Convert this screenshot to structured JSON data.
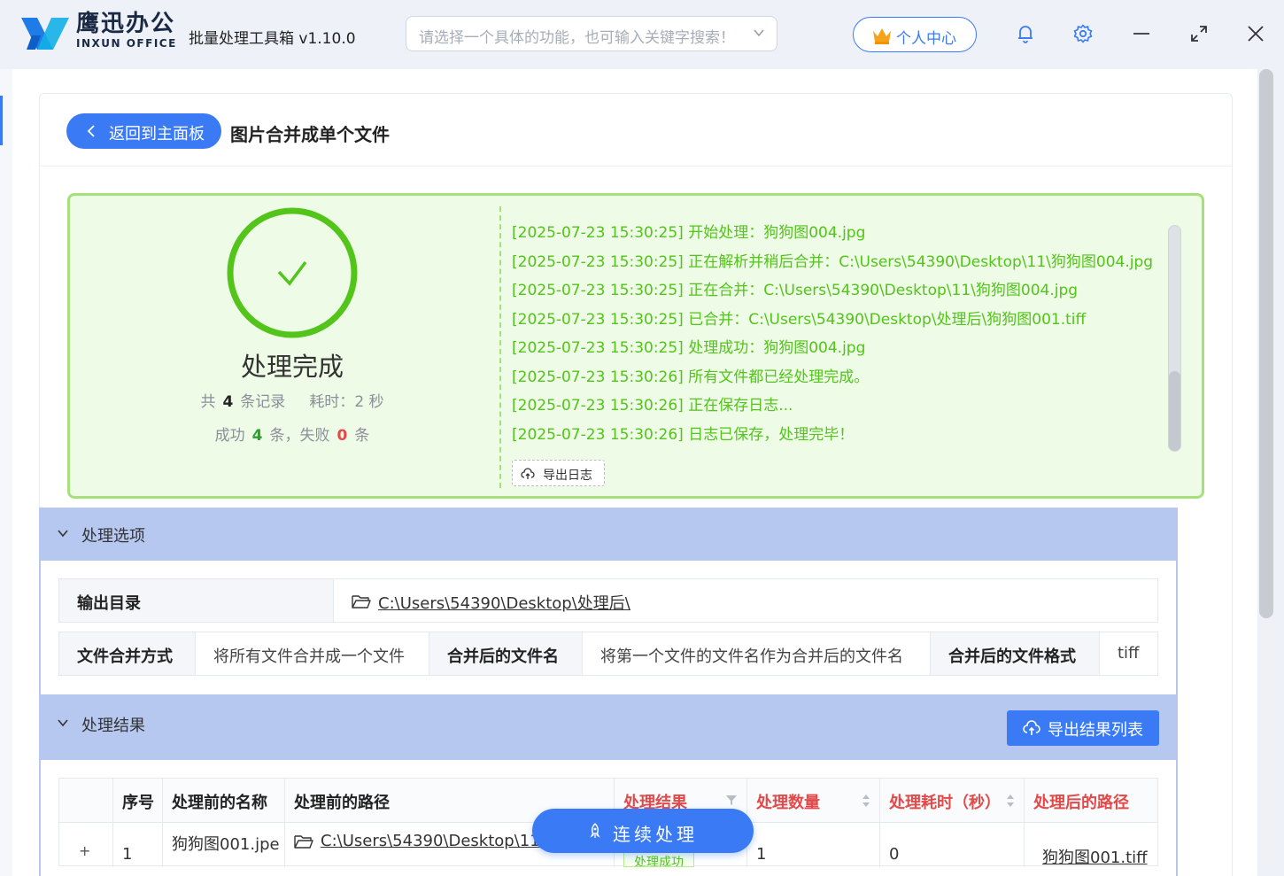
{
  "brand": {
    "name_cn": "鹰迅办公",
    "name_en": "INXUN OFFICE"
  },
  "app": {
    "title": "批量处理工具箱 v1.10.0"
  },
  "search": {
    "placeholder": "请选择一个具体的功能，也可输入关键字搜索！"
  },
  "toolbar": {
    "user_center": "个人中心"
  },
  "header": {
    "back_label": "返回到主面板",
    "page_title": "图片合并成单个文件"
  },
  "result": {
    "status": "处理完成",
    "total_prefix": "共",
    "total": "4",
    "total_suffix": "条记录",
    "time_prefix": "耗时：",
    "time_value": "2",
    "time_unit": "秒",
    "success_prefix": "成功",
    "success": "4",
    "success_suffix": "条，失败",
    "fail": "0",
    "fail_suffix": "条",
    "export_log": "导出日志",
    "log_lines": [
      "[2025-07-23 15:30:25] 开始处理：狗狗图004.jpg",
      "[2025-07-23 15:30:25] 正在解析并稍后合并：C:\\Users\\54390\\Desktop\\11\\狗狗图004.jpg",
      "[2025-07-23 15:30:25] 正在合并：C:\\Users\\54390\\Desktop\\11\\狗狗图004.jpg",
      "[2025-07-23 15:30:25] 已合并：C:\\Users\\54390\\Desktop\\处理后\\狗狗图001.tiff",
      "[2025-07-23 15:30:25] 处理成功：狗狗图004.jpg",
      "[2025-07-23 15:30:26] 所有文件都已经处理完成。",
      "[2025-07-23 15:30:26] 正在保存日志...",
      "[2025-07-23 15:30:26] 日志已保存，处理完毕！"
    ]
  },
  "options": {
    "section_title": "处理选项",
    "output_dir_label": "输出目录",
    "output_dir_value": "C:\\Users\\54390\\Desktop\\处理后\\",
    "merge_mode_label": "文件合并方式",
    "merge_mode_value": "将所有文件合并成一个文件",
    "merged_name_label": "合并后的文件名",
    "merged_name_value": "将第一个文件的文件名作为合并后的文件名",
    "merged_format_label": "合并后的文件格式",
    "merged_format_value": "tiff"
  },
  "results": {
    "section_title": "处理结果",
    "export_list": "导出结果列表",
    "columns": [
      "序号",
      "处理前的名称",
      "处理前的路径",
      "处理结果",
      "处理数量",
      "处理耗时（秒）",
      "处理后的路径"
    ],
    "rows": [
      {
        "expand": "+",
        "index": "1",
        "name": "狗狗图001.jpe",
        "path": "C:\\Users\\54390\\Desktop\\11",
        "status": "处理成功",
        "count": "1",
        "duration": "0",
        "out_path": "狗狗图001.tiff"
      }
    ]
  },
  "footer": {
    "continue_label": "连续处理"
  },
  "colors": {
    "accent": "#3a7bf5",
    "success": "#52c41a",
    "danger": "#e24a4a",
    "section_bg": "#b6c8ef",
    "result_bg": "#eefbe6"
  }
}
